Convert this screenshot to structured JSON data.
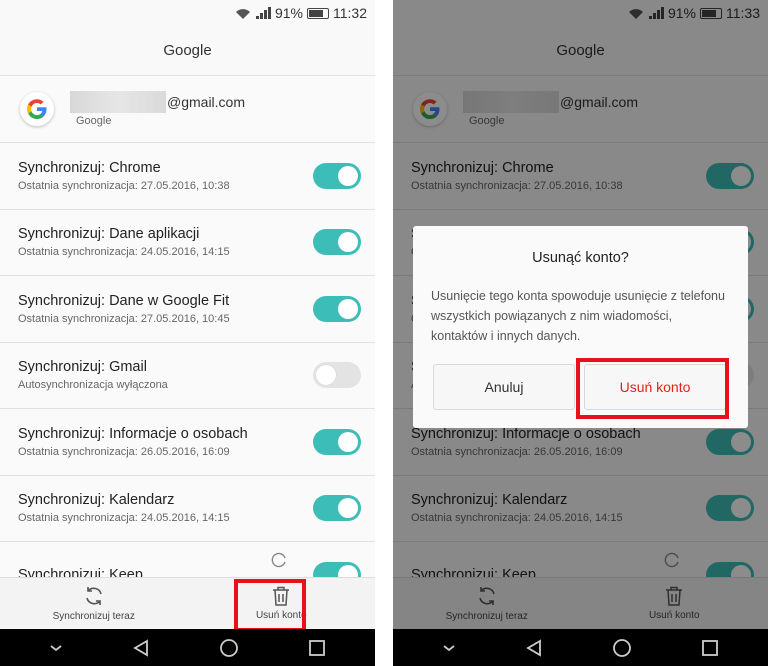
{
  "status": {
    "left": {
      "battery_pct": "91%",
      "time": "11:32"
    },
    "right": {
      "battery_pct": "91%",
      "time": "11:33"
    }
  },
  "header": {
    "title": "Google"
  },
  "account": {
    "email_suffix": "@gmail.com",
    "provider": "Google"
  },
  "sync_items": [
    {
      "title": "Synchronizuj: Chrome",
      "subtitle": "Ostatnia synchronizacja: 27.05.2016, 10:38",
      "enabled": true
    },
    {
      "title": "Synchronizuj: Dane aplikacji",
      "subtitle": "Ostatnia synchronizacja: 24.05.2016, 14:15",
      "enabled": true
    },
    {
      "title": "Synchronizuj: Dane w Google Fit",
      "subtitle": "Ostatnia synchronizacja: 27.05.2016, 10:45",
      "enabled": true
    },
    {
      "title": "Synchronizuj: Gmail",
      "subtitle": "Autosynchronizacja wyłączona",
      "enabled": false
    },
    {
      "title": "Synchronizuj: Informacje o osobach",
      "subtitle": "Ostatnia synchronizacja: 26.05.2016, 16:09",
      "enabled": true
    },
    {
      "title": "Synchronizuj: Kalendarz",
      "subtitle": "Ostatnia synchronizacja: 24.05.2016, 14:15",
      "enabled": true
    },
    {
      "title": "Synchronizuj: Keep",
      "subtitle": "",
      "enabled": true
    }
  ],
  "bottom_bar": {
    "sync_now_label": "Synchronizuj teraz",
    "remove_account_label": "Usuń konto"
  },
  "dialog": {
    "title": "Usunąć konto?",
    "message": "Usunięcie tego konta spowoduje usunięcie z telefonu wszystkich powiązanych z nim wiadomości, kontaktów i innych danych.",
    "cancel_label": "Anuluj",
    "confirm_label": "Usuń konto"
  },
  "colors": {
    "accent": "#3cbdb7",
    "highlight": "#e8101c",
    "danger": "#e2231a"
  },
  "icons": [
    "wifi-icon",
    "signal-icon",
    "battery-icon",
    "google-logo",
    "sync-icon",
    "trash-icon",
    "back-icon",
    "home-icon",
    "recents-icon",
    "nav-collapse-icon"
  ]
}
